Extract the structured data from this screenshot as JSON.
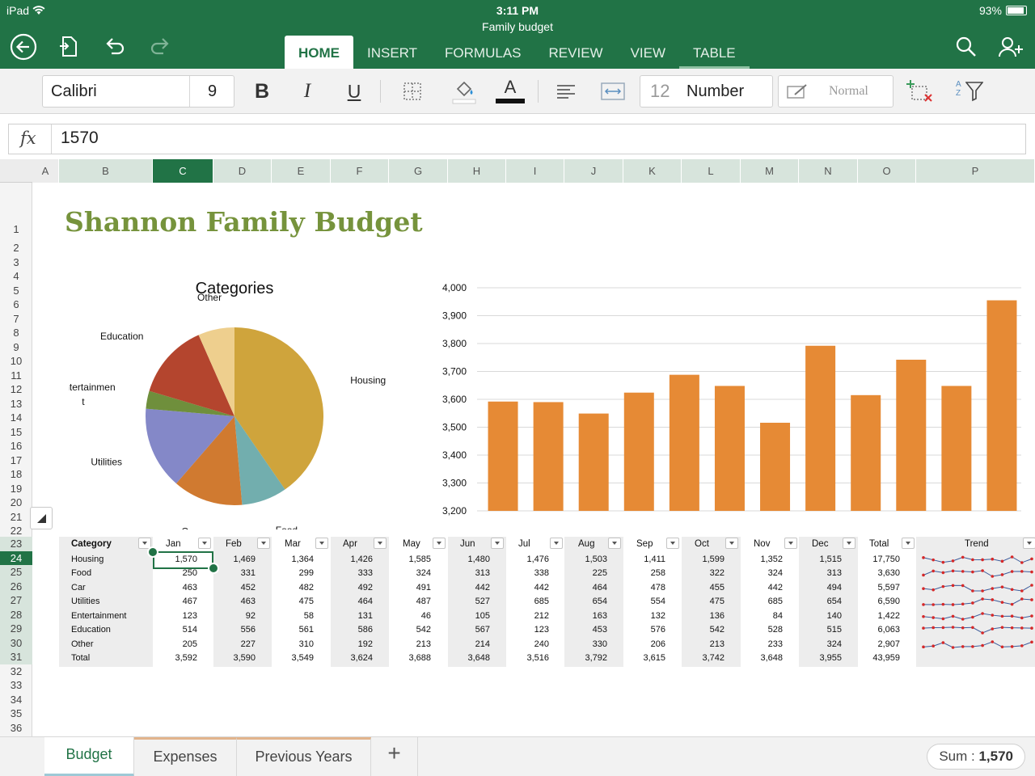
{
  "status": {
    "device": "iPad",
    "time": "3:11 PM",
    "battery": "93%"
  },
  "doc_title": "Family budget",
  "ribbon_tabs": [
    "HOME",
    "INSERT",
    "FORMULAS",
    "REVIEW",
    "VIEW",
    "TABLE"
  ],
  "toolbar": {
    "font": "Calibri",
    "size": "9",
    "bold": "B",
    "italic": "I",
    "underline": "U",
    "font_color_glyph": "A",
    "format_icon": "12",
    "format": "Number",
    "style": "Normal",
    "sort_glyph": "A Z"
  },
  "formula": {
    "fx": "fx",
    "value": "1570"
  },
  "columns": [
    "A",
    "B",
    "C",
    "D",
    "E",
    "F",
    "G",
    "H",
    "I",
    "J",
    "K",
    "L",
    "M",
    "N",
    "O",
    "P"
  ],
  "selected_column": "C",
  "rows": [
    "1",
    "2",
    "3",
    "4",
    "5",
    "6",
    "7",
    "8",
    "9",
    "10",
    "11",
    "12",
    "13",
    "14",
    "15",
    "16",
    "17",
    "18",
    "19",
    "20",
    "21",
    "22",
    "23",
    "24",
    "25",
    "26",
    "27",
    "28",
    "29",
    "30",
    "31",
    "32",
    "33",
    "34",
    "35",
    "36"
  ],
  "selected_row": "24",
  "sheet_title": "Shannon Family Budget",
  "chart_data": [
    {
      "type": "pie",
      "title": "Categories",
      "categories": [
        "Housing",
        "Food",
        "Car",
        "Utilities",
        "Entertainment",
        "Education",
        "Other"
      ],
      "values": [
        17750,
        3630,
        5597,
        6590,
        1422,
        6063,
        2907
      ],
      "labels": [
        "Housing",
        "Food",
        "Car",
        "Utilities",
        "Entertainmen t",
        "Education",
        "Other"
      ],
      "colors": [
        "#cfa43c",
        "#72aeae",
        "#d07a30",
        "#8488c8",
        "#6f8f3c",
        "#b4452e",
        "#eecf8e"
      ]
    },
    {
      "type": "bar",
      "title": "",
      "categories": [
        "Jan",
        "Feb",
        "Mar",
        "Apr",
        "May",
        "Jun",
        "Jul",
        "Aug",
        "Sep",
        "Oct",
        "Nov",
        "Dec"
      ],
      "values": [
        3592,
        3590,
        3549,
        3624,
        3688,
        3648,
        3516,
        3792,
        3615,
        3742,
        3648,
        3955
      ],
      "ylim": [
        3200,
        4000
      ],
      "yticks": [
        "3,200",
        "3,300",
        "3,400",
        "3,500",
        "3,600",
        "3,700",
        "3,800",
        "3,900",
        "4,000"
      ],
      "color": "#e68a35",
      "grid": true
    }
  ],
  "table": {
    "headers": [
      "Category",
      "Jan",
      "Feb",
      "Mar",
      "Apr",
      "May",
      "Jun",
      "Jul",
      "Aug",
      "Sep",
      "Oct",
      "Nov",
      "Dec",
      "Total",
      "Trend"
    ],
    "rows": [
      [
        "Housing",
        "1,570",
        "1,469",
        "1,364",
        "1,426",
        "1,585",
        "1,480",
        "1,476",
        "1,503",
        "1,411",
        "1,599",
        "1,352",
        "1,515",
        "17,750"
      ],
      [
        "Food",
        "250",
        "331",
        "299",
        "333",
        "324",
        "313",
        "338",
        "225",
        "258",
        "322",
        "324",
        "313",
        "3,630"
      ],
      [
        "Car",
        "463",
        "452",
        "482",
        "492",
        "491",
        "442",
        "442",
        "464",
        "478",
        "455",
        "442",
        "494",
        "5,597"
      ],
      [
        "Utilities",
        "467",
        "463",
        "475",
        "464",
        "487",
        "527",
        "685",
        "654",
        "554",
        "475",
        "685",
        "654",
        "6,590"
      ],
      [
        "Entertainment",
        "123",
        "92",
        "58",
        "131",
        "46",
        "105",
        "212",
        "163",
        "132",
        "136",
        "84",
        "140",
        "1,422"
      ],
      [
        "Education",
        "514",
        "556",
        "561",
        "586",
        "542",
        "567",
        "123",
        "453",
        "576",
        "542",
        "528",
        "515",
        "6,063"
      ],
      [
        "Other",
        "205",
        "227",
        "310",
        "192",
        "213",
        "214",
        "240",
        "330",
        "206",
        "213",
        "233",
        "324",
        "2,907"
      ],
      [
        "Total",
        "3,592",
        "3,590",
        "3,549",
        "3,624",
        "3,688",
        "3,648",
        "3,516",
        "3,792",
        "3,615",
        "3,742",
        "3,648",
        "3,955",
        "43,959"
      ]
    ]
  },
  "sheet_tabs": [
    "Budget",
    "Expenses",
    "Previous Years"
  ],
  "add_sheet": "+",
  "sum": {
    "label": "Sum :",
    "value": "1,570"
  }
}
